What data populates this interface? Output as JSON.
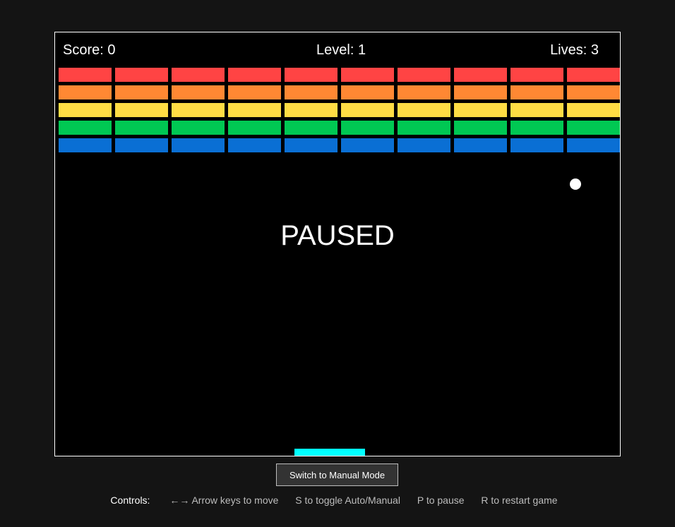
{
  "hud": {
    "score_label": "Score:",
    "score": "0",
    "level_label": "Level:",
    "level": "1",
    "lives_label": "Lives:",
    "lives": "3"
  },
  "bricks": {
    "columns": 10,
    "rows": [
      {
        "color": "#ff4444"
      },
      {
        "color": "#ff8833"
      },
      {
        "color": "#ffdd44"
      },
      {
        "color": "#00c853"
      },
      {
        "color": "#0a6fd4"
      }
    ]
  },
  "ball": {
    "color": "#ffffff"
  },
  "paddle": {
    "color": "#00ffff"
  },
  "overlay": {
    "text": "PAUSED"
  },
  "mode_button": {
    "label": "Switch to Manual Mode"
  },
  "controls": {
    "label": "Controls:",
    "items": [
      "←→ Arrow keys to move",
      "S to toggle Auto/Manual",
      "P to pause",
      "R to restart game"
    ]
  }
}
